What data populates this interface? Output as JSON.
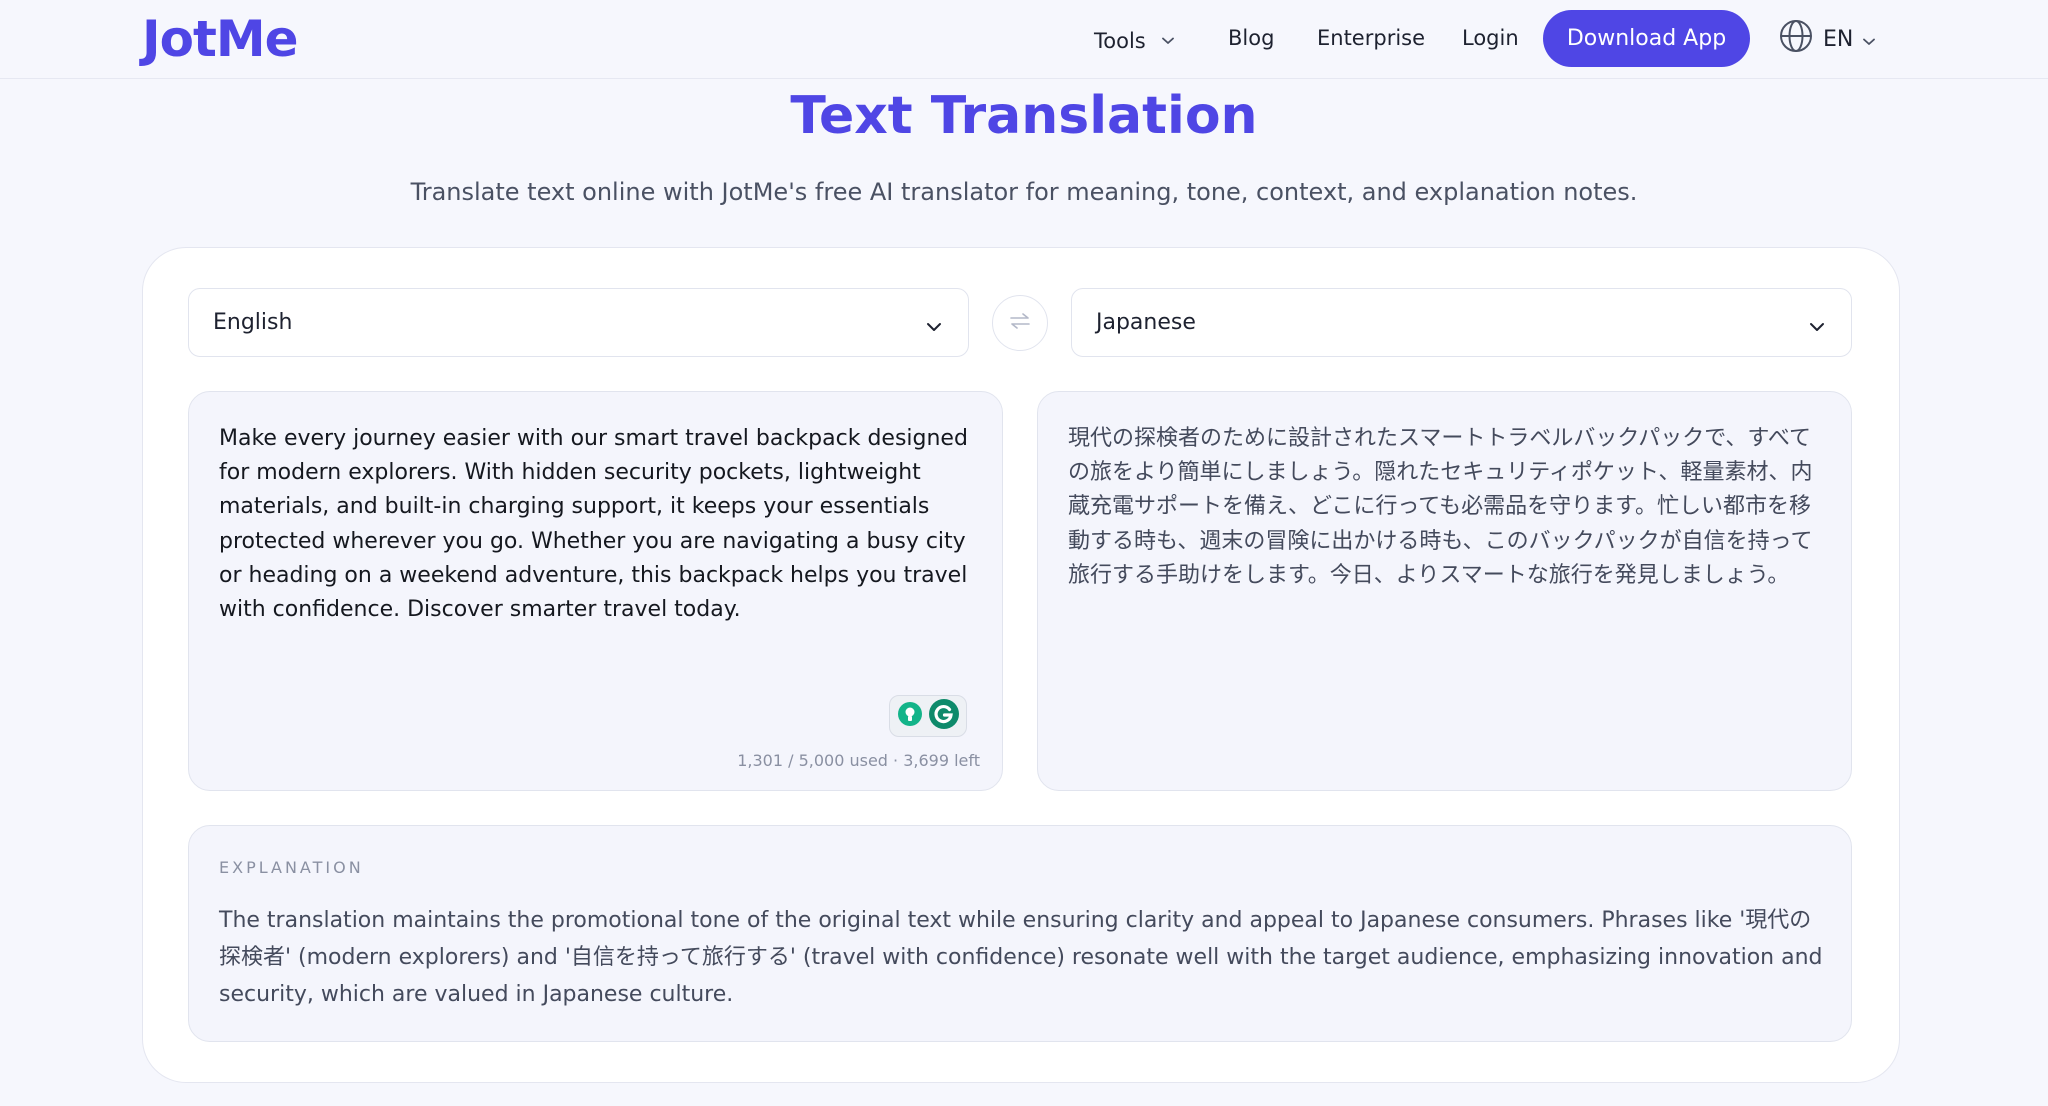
{
  "header": {
    "logo": "JotMe",
    "nav": {
      "tools": "Tools",
      "blog": "Blog",
      "enterprise": "Enterprise",
      "login": "Login"
    },
    "download_button": "Download App",
    "language": "EN"
  },
  "hero": {
    "title": "Text Translation",
    "subtitle": "Translate text online with JotMe's free AI translator for meaning, tone, context, and explanation notes."
  },
  "translator": {
    "source_language": "English",
    "target_language": "Japanese",
    "source_text": "Make every journey easier with our smart travel backpack designed for modern explorers. With hidden security pockets, lightweight materials, and built-in charging support, it keeps your essentials protected wherever you go. Whether you are navigating a busy city or heading on a weekend adventure, this backpack helps you travel with confidence. Discover smarter travel today.",
    "translated_text": "現代の探検者のために設計されたスマートトラベルバックパックで、すべての旅をより簡単にしましょう。隠れたセキュリティポケット、軽量素材、内蔵充電サポートを備え、どこに行っても必需品を守ります。忙しい都市を移動する時も、週末の冒険に出かける時も、このバックパックが自信を持って旅行する手助けをします。今日、よりスマートな旅行を発見しましょう。",
    "char_count": "1,301 / 5,000 used · 3,699 left",
    "explanation_label": "EXPLANATION",
    "explanation_text": "The translation maintains the promotional tone of the original text while ensuring clarity and appeal to Japanese consumers. Phrases like '現代の探検者' (modern explorers) and '自信を持って旅行する' (travel with confidence) resonate well with the target audience, emphasizing innovation and security, which are valued in Japanese culture."
  },
  "icons": {
    "tools_dropdown": "chevron-down-icon",
    "globe": "globe-icon",
    "language_dropdown": "chevron-down-icon",
    "source_dropdown": "chevron-down-icon",
    "target_dropdown": "chevron-down-icon",
    "swap": "swap-arrows-icon",
    "extension_1": "lightbulb-icon",
    "extension_2": "grammarly-icon"
  },
  "colors": {
    "brand": "#4f46e5",
    "page_bg": "#f6f7fd",
    "card_bg": "#ffffff",
    "panel_bg": "#f4f5fc",
    "grammarly": "#15c39a"
  }
}
